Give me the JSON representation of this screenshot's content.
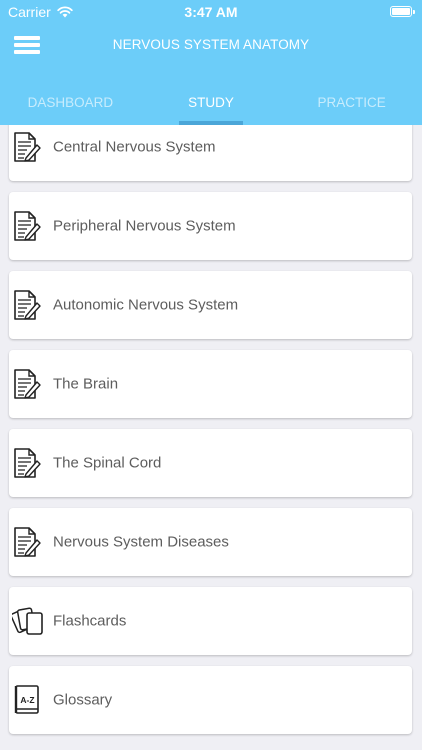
{
  "status_bar": {
    "carrier": "Carrier",
    "time": "3:47 AM"
  },
  "header": {
    "title": "NERVOUS SYSTEM ANATOMY",
    "background_color": "#6ccdf9",
    "menu_icon": "hamburger-menu-icon"
  },
  "tabs": [
    {
      "label": "DASHBOARD",
      "active": false
    },
    {
      "label": "STUDY",
      "active": true
    },
    {
      "label": "PRACTICE",
      "active": false
    }
  ],
  "items": [
    {
      "label": "Central Nervous System",
      "icon": "document-edit-icon"
    },
    {
      "label": "Peripheral Nervous System",
      "icon": "document-edit-icon"
    },
    {
      "label": "Autonomic Nervous System",
      "icon": "document-edit-icon"
    },
    {
      "label": "The Brain",
      "icon": "document-edit-icon"
    },
    {
      "label": "The Spinal Cord",
      "icon": "document-edit-icon"
    },
    {
      "label": "Nervous System Diseases",
      "icon": "document-edit-icon"
    },
    {
      "label": "Flashcards",
      "icon": "flashcards-icon"
    },
    {
      "label": "Glossary",
      "icon": "glossary-book-icon",
      "icon_text": "A-Z"
    }
  ]
}
